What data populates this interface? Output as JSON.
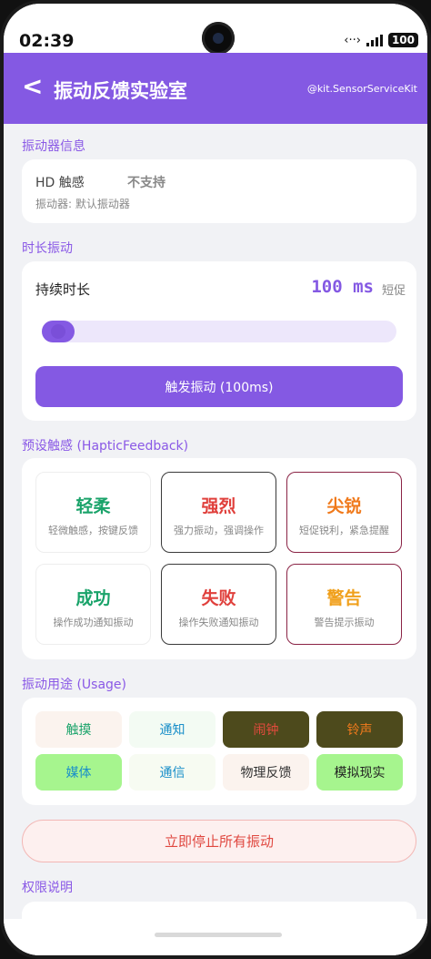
{
  "status": {
    "time": "02:39",
    "battery": "100"
  },
  "header": {
    "back_glyph": "<",
    "title": "振动反馈实验室",
    "kit": "@kit.SensorServiceKit"
  },
  "vibrator_info": {
    "section": "振动器信息",
    "hd_label": "HD 触感",
    "hd_value": "不支持",
    "vibrator": "振动器: 默认振动器"
  },
  "duration": {
    "section": "时长振动",
    "label": "持续时长",
    "value": "100 ms",
    "hint": "短促",
    "slider_fraction": 0.09,
    "button": "触发振动 (100ms)"
  },
  "haptic": {
    "section": "预设触感 (HapticFeedback)",
    "tiles": [
      {
        "title": "轻柔",
        "sub": "轻微触感，按键反馈",
        "color": "#1aa36a",
        "border": "#eeeeee"
      },
      {
        "title": "强烈",
        "sub": "强力振动，强调操作",
        "color": "#e0403c",
        "border": "#3a3a3a"
      },
      {
        "title": "尖锐",
        "sub": "短促锐利，紧急提醒",
        "color": "#f07a1c",
        "border": "#8a2345"
      },
      {
        "title": "成功",
        "sub": "操作成功通知振动",
        "color": "#1aa36a",
        "border": "#eeeeee"
      },
      {
        "title": "失败",
        "sub": "操作失败通知振动",
        "color": "#e0403c",
        "border": "#3a3a3a"
      },
      {
        "title": "警告",
        "sub": "警告提示振动",
        "color": "#f0a01c",
        "border": "#8a2345"
      }
    ]
  },
  "usage": {
    "section": "振动用途 (Usage)",
    "chips": [
      {
        "label": "触摸",
        "bg": "#fbf3ee",
        "fg": "#1aa36a"
      },
      {
        "label": "通知",
        "bg": "#f3fbf3",
        "fg": "#1a8fc9"
      },
      {
        "label": "闹钟",
        "bg": "#4d4a1c",
        "fg": "#e44b3e"
      },
      {
        "label": "铃声",
        "bg": "#4d4a1c",
        "fg": "#f07a1c"
      },
      {
        "label": "媒体",
        "bg": "#a6f58e",
        "fg": "#1a8fc9"
      },
      {
        "label": "通信",
        "bg": "#f7fbf2",
        "fg": "#1a8fc9"
      },
      {
        "label": "物理反馈",
        "bg": "#fbf3ee",
        "fg": "#333333"
      },
      {
        "label": "模拟现实",
        "bg": "#a6f58e",
        "fg": "#222222"
      }
    ]
  },
  "stop_button": "立即停止所有振动",
  "permissions": {
    "section": "权限说明"
  },
  "colors": {
    "accent": "#8459e3",
    "danger": "#e04840"
  }
}
